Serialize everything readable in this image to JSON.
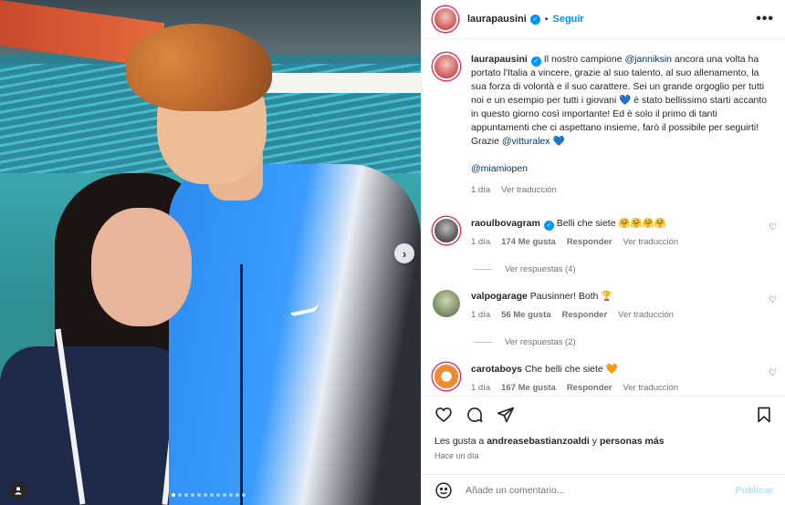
{
  "post": {
    "image_alt": "",
    "carousel_dots": 12,
    "active_dot": 0
  },
  "header": {
    "username": "laurapausini",
    "separator": "•",
    "follow_label": "Seguir",
    "more_label": "•••"
  },
  "caption": {
    "username": "laurapausini",
    "parts": [
      "Il nostro campione ",
      "@janniksin",
      " ancora una volta ha portato l'Italia a vincere, grazie al suo talento, al suo allenamento, la sua forza di volontà e il suo carattere. Sei un grande orgoglio per tutti noi e un esempio per tutti i giovani 💙 è stato bellissimo starti accanto in questo giorno così importante! Ed è solo il primo di tanti appuntamenti che ci aspettano insieme, farò il possibile per seguirti! Grazie ",
      "@vitturalex",
      " 💙"
    ],
    "tag": "@miamiopen",
    "time": "1 día",
    "translate": "Ver traducción"
  },
  "comments": [
    {
      "username": "raoulbovagram",
      "verified": true,
      "text": "Belli che siete 🤗🤗🤗🤗",
      "time": "1 día",
      "likes": "174 Me gusta",
      "reply": "Responder",
      "translate": "Ver traducción",
      "replies": "Ver respuestas (4)"
    },
    {
      "username": "valpogarage",
      "verified": false,
      "text": "Pausinner! Both 🏆",
      "time": "1 día",
      "likes": "56 Me gusta",
      "reply": "Responder",
      "translate": "Ver traducción",
      "replies": "Ver respuestas (2)"
    },
    {
      "username": "carotaboys",
      "verified": false,
      "text": "Che belli che siete 🧡",
      "time": "1 día",
      "likes": "167 Me gusta",
      "reply": "Responder",
      "translate": "Ver traducción"
    }
  ],
  "likes_line": {
    "prefix": "Les gusta a ",
    "user": "andreasebastianzoaldi",
    "middle": " y ",
    "others": "personas más"
  },
  "posted": "Hace un día",
  "add_comment": {
    "placeholder": "Añade un comentario...",
    "publish": "Publicar"
  },
  "icons": [
    "heart-icon",
    "comment-icon",
    "share-icon",
    "bookmark-icon",
    "emoji-icon",
    "more-icon",
    "verified-icon",
    "chevron-right-icon",
    "user-tag-icon"
  ],
  "colors": {
    "link": "#00376b",
    "follow": "#0095f6",
    "muted": "#737373",
    "publish_disabled": "#b2dffc"
  }
}
